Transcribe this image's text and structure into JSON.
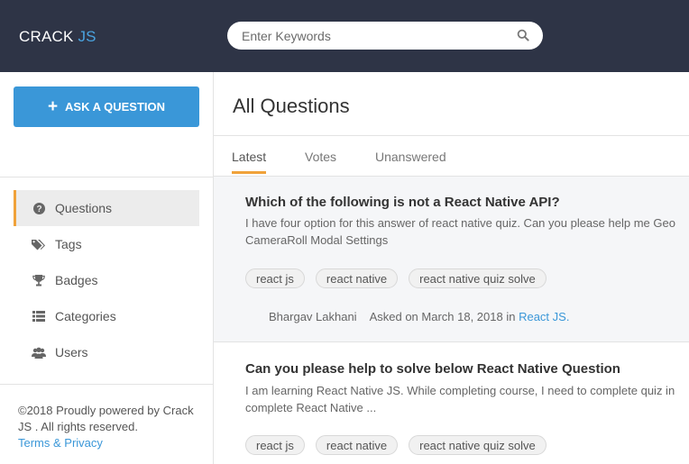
{
  "header": {
    "logo_main": "CRACK",
    "logo_accent": "JS",
    "search_placeholder": "Enter Keywords"
  },
  "sidebar": {
    "ask_button": "ASK A QUESTION",
    "nav": [
      {
        "label": "Questions",
        "icon": "question-circle-icon"
      },
      {
        "label": "Tags",
        "icon": "tags-icon"
      },
      {
        "label": "Badges",
        "icon": "trophy-icon"
      },
      {
        "label": "Categories",
        "icon": "list-icon"
      },
      {
        "label": "Users",
        "icon": "users-icon"
      }
    ],
    "footer_text": "©2018 Proudly powered by Crack JS . All rights reserved.",
    "footer_link": "Terms & Privacy"
  },
  "main": {
    "title": "All Questions",
    "tabs": [
      "Latest",
      "Votes",
      "Unanswered"
    ],
    "questions": [
      {
        "title": "Which of the following is not a React Native API?",
        "excerpt": "I have four option for this answer of react native quiz.  Can you please help me Geo\nCameraRoll Modal Settings",
        "tags": [
          "react js",
          "react native",
          "react native quiz solve"
        ],
        "author": "Bhargav Lakhani",
        "asked": "Asked on March 18, 2018 in ",
        "category": "React JS."
      },
      {
        "title": "Can you please help to solve below React Native Question",
        "excerpt": "I am learning React Native JS. While completing course, I need to complete quiz in\ncomplete React Native ...",
        "tags": [
          "react js",
          "react native",
          "react native quiz solve"
        ]
      }
    ]
  },
  "colors": {
    "header_bg": "#2e3446",
    "accent_blue": "#3a97d8",
    "accent_orange": "#f0a23a"
  }
}
